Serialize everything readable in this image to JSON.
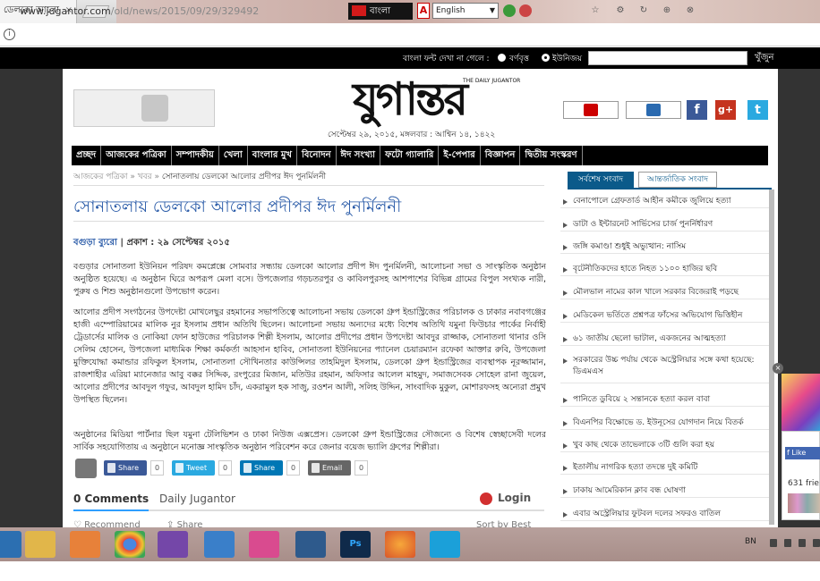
{
  "browser": {
    "tab_title": "ডেলকো আলো",
    "tab_close": "×",
    "ext_label": "বাংলা",
    "ext_a": "A",
    "lang_select": "English",
    "url_domain": "www.jugantor.com",
    "url_path": "/old/news/2015/09/29/329492"
  },
  "site_top": {
    "label": "বাংলা ফন্ট দেখা না গেলে :",
    "opt1": "বর্ণবৃত্ত",
    "opt2": "ইউনিজয়",
    "search_btn": "খুঁজুন"
  },
  "header": {
    "logo": "যুগান্তর",
    "logo_en": "THE DAILY JUGANTOR",
    "date": "সেপ্টেম্বর ২৯, ২০১৫, মঙ্গলবার : আশ্বিন ১৪, ১৪২২",
    "facebook": "f",
    "googleplus": "g+",
    "twitter": "t"
  },
  "nav": [
    "প্রচ্ছদ",
    "আজকের পত্রিকা",
    "সম্পাদকীয়",
    "খেলা",
    "বাংলার মুখ",
    "বিনোদন",
    "ঈদ সংখ্যা",
    "ফটো গ্যালারি",
    "ই-পেপার",
    "বিজ্ঞাপন",
    "দ্বিতীয় সংস্করণ"
  ],
  "article": {
    "crumb_1": "আজকের পত্রিকা",
    "crumb_sep": "»",
    "crumb_2": "খবর",
    "crumb_3": "সোনাতলায় ডেলকো আলোর প্রদীপর ঈদ পুনর্মিলনী",
    "headline": "সোনাতলায় ডেলকো আলোর প্রদীপর ঈদ পুনর্মিলনী",
    "byline_name": "বগুড়া ব্যুরো",
    "byline_rest": " | প্রকাশ : ২৯ সেপ্টেম্বর ২০১৫",
    "p1": "বগুড়ার সোনাতলা ইউনিয়ন পরিষদ কমপ্লেক্সে সোমবার সন্ধ্যায় ডেলকো আলোর প্রদীপ ঈদ পুনর্মিলনী, আলোচনা সভা ও সাংস্কৃতিক অনুষ্ঠান অনুষ্ঠিত হয়েছে। এ অনুষ্ঠান ঘিরে অপরূপ মেলা বসে। উপজেলার গড়চতরপুর ও কাবিলপুরসহ আশপাশের বিভিন্ন গ্রামের বিপুল সংখ্যক নারী, পুরুষ ও শিশু অনুষ্ঠানগুলো উপভোগ করেন।",
    "p2": "আলোর প্রদীপ সংগঠনের উপদেষ্টা মোখলেছুর রহমানের সভাপতিত্বে আলোচনা সভায় ডেলকো গ্রুপ ইন্ডাস্ট্রিজের পরিচালক ও ঢাকার নবাবগঞ্জের হাজী এম্পোরিয়ামের মালিক নুর ইসলাম প্রধান অতিথি ছিলেন। আলোচনা সভায় অন্যদের মধ্যে বিশেষ অতিথি যমুনা ফিউচার পার্কের নির্বাহী ট্রেডার্সের মালিক ও নোকিয়া ফোন হাউজের পরিচালক শিল্পী ইসলাম, আলোর প্রদীপের প্রধান উপদেষ্টা আবদুর রাজ্জাক, সোনাতলা থানার ওসি সেলিম হোসেন, উপজেলা মাধ্যমিক শিক্ষা কর্মকর্তা আহসান হাবিব, সোনাতলা ইউনিয়নের প্যানেল চেয়ারম্যান রফেকা আক্তার রুবি, উপজেলা মুক্তিযোদ্ধা কমান্ডার রফিকুল ইসলাম, সোনাতলা সৌখিনতার কাউন্সিলর তাহমিদুল ইসলাম, ডেলকো গ্রুপ ইন্ডাস্ট্রিজের ব্যবস্থাপক নূরজ্জামান, রাজশাহীর এরিয়া ম্যানেজার আবু বক্কর সিদ্দিক, রংপুরের মিজান, মতিউর রহমান, অফিসার আলেল মাহমুদ, সমাজসেবক সোহেল রানা জুয়েল, আলোর প্রদীপের আবদুল গফুর, আবদুল হামিদ চাঁদ, একরামুল হক সাজু, রওশন আলী, সলিহ উদ্দিন, সাংবাদিক মুকুল, মোশারফসহ অন্যেরা প্রমুখ উপস্থিত ছিলেন।",
    "p3": "অনুষ্ঠানের মিডিয়া পার্টনার ছিল যমুনা টেলিভিশন ও ঢাকা নিউজ এক্সপ্রেস। ডেলকো গ্রুপ ইন্ডাস্ট্রিজের সৌজন্যে ও বিশেষ স্বেচ্ছাসেবী দলের সার্বিক সহযোগিতায় এ অনুষ্ঠানে মনোজ্ঞ সাংস্কৃতিক অনুষ্ঠান পরিবেশন করে জেনার বয়েজ ভ্যালি গ্রুপের শিল্পীরা।"
  },
  "share": {
    "fb_label": "Share",
    "fb_count": "0",
    "tw_label": "Tweet",
    "tw_count": "0",
    "li_label": "Share",
    "li_count": "0",
    "em_label": "Email",
    "em_count": "0"
  },
  "comments": {
    "count": "0 Comments",
    "site": "Daily Jugantor",
    "login": "Login",
    "recommend": "Recommend",
    "share": "Share",
    "sort": "Sort by Best"
  },
  "sidebar": {
    "tab_latest": "সর্বশেষ সংবাদ",
    "tab_intl": "আন্তর্জাতিক সংবাদ",
    "items": [
      "বেনাপোলে গ্রেফতার্ড আহীন কমীকে জুলিয়ে হত্যা",
      "ডাটা ও ইন্টারনেট সার্ভিসের চার্জ পুনর্নির্ধারণ",
      "জঙ্গি কমাণ্ডা শুধুই অভ্যুত্থান: নাসিম",
      "বৃটেনীতিকদের হাতে নিহত ১১০০ হাজির ছবি",
      "মৌলভাল নামের কাল খালে সরকার বিজেরাই পড়ছে",
      "মেডিকেল ভর্তিতে প্রশ্নপত্র ফাঁসের অভিযোগ ভিত্তিহীন",
      "৬১ জাতীয় ছেলো ভাটাল, একজনের আত্মহত্যা",
      "সরকারের উচ্চ পর্যায় থেকে অস্ট্রেলিয়ার সঙ্গে কথা হয়েছে: ডিএমএস",
      "পানিতে ডুবিয়ে ২ সন্তানকে হত্যা করল বাবা",
      "বিএনপির বিক্ষোভে ড. ইউনূসের যোগদান নিয়ে বিতর্ক",
      "খুব কাছ থেকে তাভেলাকে ৩টি গুলি করা হয়",
      "ইতালীয় নাগরিক হত্যা তদন্তে দুই কমিটি",
      "ঢাকায় আমেরিকান ক্লাব বন্ধ ঘোষণা",
      "এবার অস্ট্রেলিয়ার ফুটবল দলের সফরও বাতিল"
    ]
  },
  "right_ad": {
    "close": "×",
    "fb_like": "Like",
    "friends": "631 frie"
  },
  "taskbar": {
    "ps_label": "Ps",
    "lang": "BN"
  }
}
